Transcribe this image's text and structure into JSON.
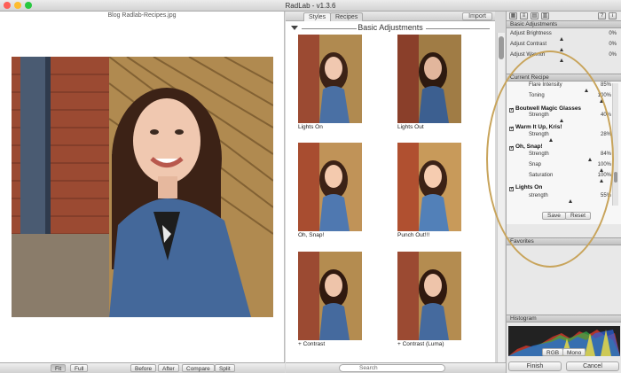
{
  "window": {
    "title": "RadLab - v1.3.6"
  },
  "image_pane": {
    "filename": "Blog Radlab-Recipes.jpg",
    "bottom_buttons": [
      "Fit",
      "Full",
      "Before",
      "After",
      "Compare",
      "Split"
    ]
  },
  "styles_pane": {
    "tabs": [
      "Styles",
      "Recipes"
    ],
    "import_label": "Import",
    "section_title": "Basic Adjustments",
    "thumbnails": [
      {
        "caption": "Lights On"
      },
      {
        "caption": "Lights Out"
      },
      {
        "caption": "Oh, Snap!"
      },
      {
        "caption": "Punch Out!!!"
      },
      {
        "caption": "+ Contrast"
      },
      {
        "caption": "+ Contrast (Luma)"
      }
    ],
    "search_label": "Search"
  },
  "right_panel": {
    "basic_adjustments": {
      "title": "Basic Adjustments",
      "rows": [
        {
          "label": "Adjust Brightness",
          "value": "0%"
        },
        {
          "label": "Adjust Contrast",
          "value": "0%"
        },
        {
          "label": "Adjust Warmth",
          "value": "0%"
        }
      ]
    },
    "current_recipe": {
      "title": "Current Recipe",
      "items": [
        {
          "kind": "param",
          "label": "Flare Intensity",
          "value": "85%"
        },
        {
          "kind": "param",
          "label": "Toning",
          "value": "100%"
        },
        {
          "kind": "style",
          "label": "Boutwell Magic Glasses"
        },
        {
          "kind": "param",
          "label": "Strength",
          "value": "40%"
        },
        {
          "kind": "style",
          "label": "Warm It Up, Kris!"
        },
        {
          "kind": "param",
          "label": "Strength",
          "value": "28%"
        },
        {
          "kind": "style",
          "label": "Oh, Snap!"
        },
        {
          "kind": "param",
          "label": "Strength",
          "value": "84%"
        },
        {
          "kind": "param",
          "label": "Snap",
          "value": "100%"
        },
        {
          "kind": "param",
          "label": "Saturation",
          "value": "100%"
        },
        {
          "kind": "style",
          "label": "Lights On"
        },
        {
          "kind": "param",
          "label": "strength",
          "value": "55%"
        }
      ],
      "save_label": "Save",
      "reset_label": "Reset"
    },
    "favorites_title": "Favorites",
    "histogram": {
      "title": "Histogram",
      "modes": [
        "RGB",
        "Mono"
      ]
    },
    "finish_label": "Finish",
    "cancel_label": "Cancel"
  },
  "colors": {
    "accent_oval": "#c8a45b",
    "traffic_red": "#fe5f57",
    "traffic_yellow": "#febc2e",
    "traffic_green": "#28c840"
  }
}
